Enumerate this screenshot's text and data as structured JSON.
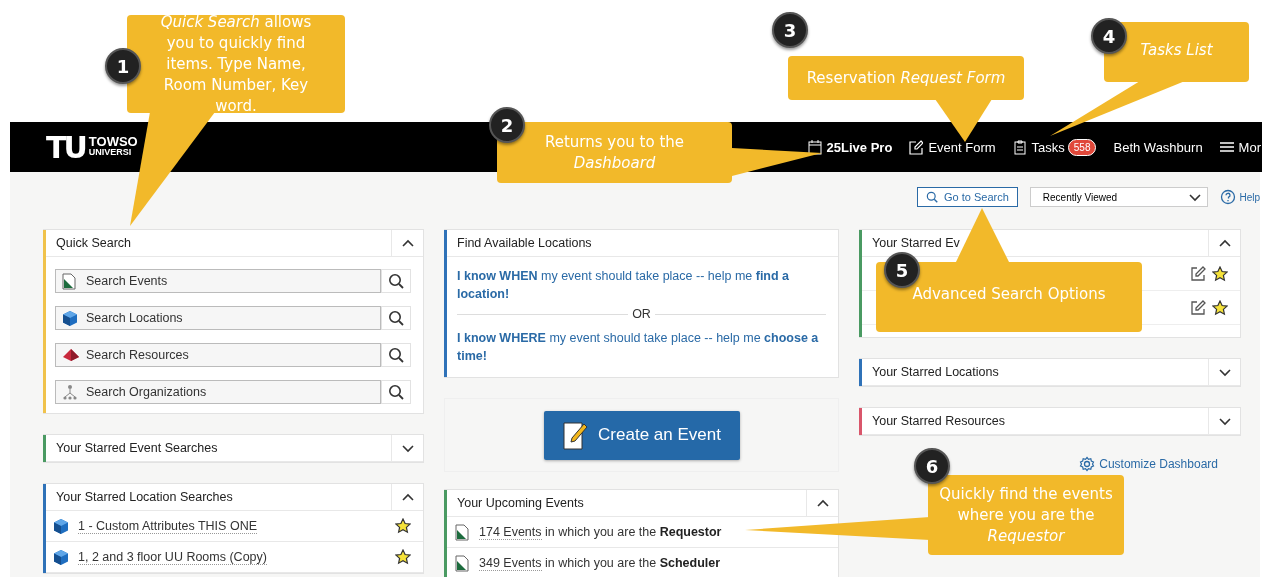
{
  "header": {
    "logo_mark": "TU",
    "logo_line_1": "TOWSO",
    "logo_line_2": "UNIVERSI",
    "nav": [
      {
        "label": "25Live Pro",
        "kind": "home"
      },
      {
        "label": "Event Form",
        "kind": "form"
      },
      {
        "label": "Tasks",
        "kind": "tasks",
        "badge": "558"
      },
      {
        "label": "Beth Washburn",
        "kind": "user"
      },
      {
        "label": "Mor",
        "kind": "menu"
      }
    ]
  },
  "toolbar": {
    "search_button": "Go to Search",
    "recent_select": "Recently Viewed",
    "help": "Help"
  },
  "columns": [
    [
      {
        "kind": "quick_search",
        "title": "Quick Search",
        "expanded": true,
        "color": "#f0c24b",
        "searches": [
          {
            "placeholder": "Search Events",
            "kind": "event"
          },
          {
            "placeholder": "Search Locations",
            "kind": "location"
          },
          {
            "placeholder": "Search Resources",
            "kind": "resource"
          },
          {
            "placeholder": "Search Organizations",
            "kind": "organization"
          }
        ]
      },
      {
        "kind": "list",
        "title": "Your Starred Event Searches",
        "expanded": false,
        "color": "#4a9a62"
      },
      {
        "kind": "list",
        "title": "Your Starred Location Searches",
        "expanded": true,
        "color": "#2f72b8",
        "items": [
          {
            "label": "1 - Custom Attributes THIS ONE",
            "kind": "location",
            "starred": true
          },
          {
            "label": "1, 2 and 3 floor UU Rooms (Copy)",
            "kind": "location",
            "starred": true
          }
        ]
      }
    ],
    [
      {
        "kind": "find",
        "title": "Find Available Locations",
        "color": "#2f72b8",
        "options": [
          "**I know WHEN** my event should take place -- help me **find a location!**",
          "**I know WHERE** my event should take place -- help me **choose a time!**"
        ],
        "separator": "OR"
      },
      {
        "kind": "create",
        "button": "Create an Event"
      },
      {
        "kind": "events",
        "title": "Your Upcoming Events",
        "expanded": true,
        "color": "#4a9a62",
        "items": [
          {
            "count": "174 Events",
            "text": " in which you are the **Requestor**"
          },
          {
            "count": "349 Events",
            "text": " in which you are the **Scheduler**"
          }
        ]
      }
    ],
    [
      {
        "kind": "starred",
        "title": "Your Starred Ev",
        "expanded": true,
        "color": "#4a9a62",
        "items": [
          {
            "starred": true
          },
          {
            "starred": true
          }
        ]
      },
      {
        "kind": "list",
        "title": "Your Starred Locations",
        "expanded": false,
        "color": "#2f72b8"
      },
      {
        "kind": "list",
        "title": "Your Starred Resources",
        "expanded": false,
        "color": "#d9566b"
      },
      {
        "kind": "customize",
        "label": "Customize Dashboard"
      }
    ]
  ],
  "callouts": [
    {
      "number": "1",
      "text": "*Quick Search* allows you to quickly find items. Type Name, Room Number, Key word."
    },
    {
      "number": "2",
      "text": "Returns you to the *Dashboard*"
    },
    {
      "number": "3",
      "text": "Reservation *Request Form*"
    },
    {
      "number": "4",
      "text": "*Tasks List*"
    },
    {
      "number": "5",
      "text": "Advanced Search Options"
    },
    {
      "number": "6",
      "text": "Quickly find the events where you are the *Requestor*"
    }
  ]
}
